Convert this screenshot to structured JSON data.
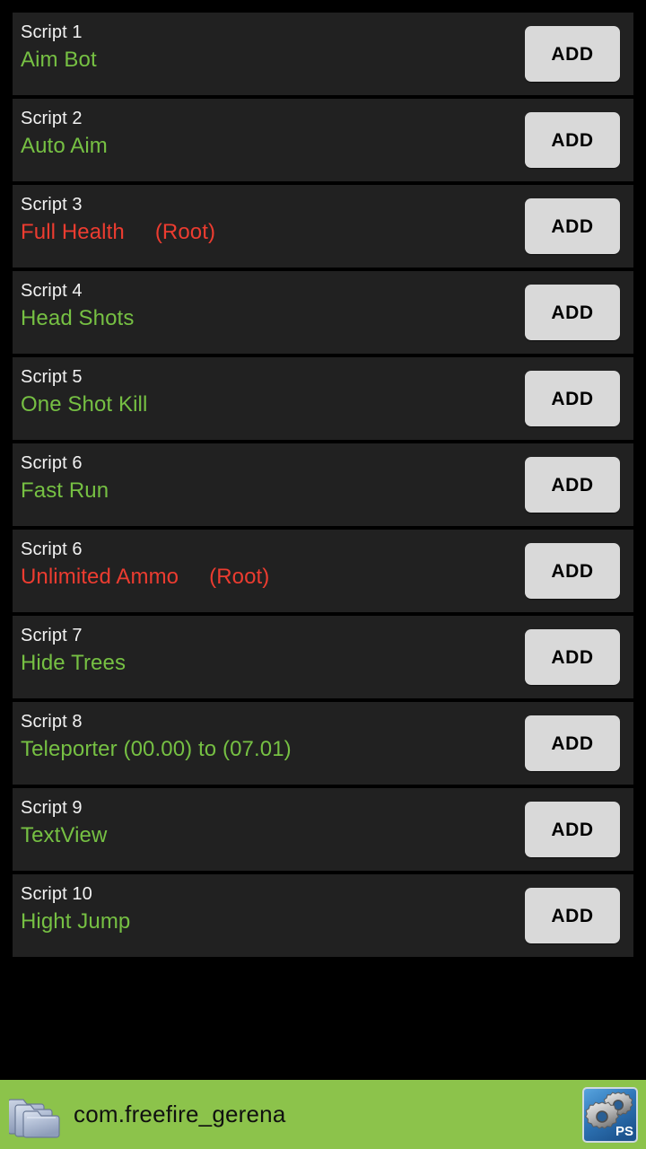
{
  "window": {
    "background_color": "#000000",
    "card_color": "#212121"
  },
  "colors": {
    "green": "#76c043",
    "red": "#ec3c30",
    "button": "#d9d9d9",
    "bottom_bar": "#8cc34b",
    "label": "#f2f2f2"
  },
  "list": {
    "add_label": "ADD",
    "rows": [
      {
        "label": "Script 1",
        "title": "Aim Bot",
        "title_color": "green",
        "tag": "",
        "button": "ADD"
      },
      {
        "label": "Script 2",
        "title": "Auto Aim",
        "title_color": "green",
        "tag": "",
        "button": "ADD"
      },
      {
        "label": "Script 3",
        "title": "Full Health",
        "title_color": "red",
        "tag": "(Root)",
        "button": "ADD"
      },
      {
        "label": "Script 4",
        "title": "Head Shots",
        "title_color": "green",
        "tag": "",
        "button": "ADD"
      },
      {
        "label": "Script 5",
        "title": "One Shot Kill",
        "title_color": "green",
        "tag": "",
        "button": "ADD"
      },
      {
        "label": "Script 6",
        "title": "Fast Run",
        "title_color": "green",
        "tag": "",
        "button": "ADD"
      },
      {
        "label": "Script 6",
        "title": "Unlimited Ammo",
        "title_color": "red",
        "tag": "(Root)",
        "button": "ADD"
      },
      {
        "label": "Script 7",
        "title": "Hide Trees",
        "title_color": "green",
        "tag": "",
        "button": "ADD"
      },
      {
        "label": "Script 8",
        "title": "Teleporter (00.00) to (07.01)",
        "title_color": "green",
        "tag": "",
        "button": "ADD"
      },
      {
        "label": "Script 9",
        "title": "TextView",
        "title_color": "green",
        "tag": "",
        "button": "ADD"
      },
      {
        "label": "Script 10",
        "title": "Hight Jump",
        "title_color": "green",
        "tag": "",
        "button": "ADD"
      }
    ]
  },
  "bottom_bar": {
    "folder_icon": "folder-stack-icon",
    "package_name": "com.freefire_gerena",
    "app_icon": "gears-ps-app-icon",
    "app_icon_text": "PS"
  }
}
